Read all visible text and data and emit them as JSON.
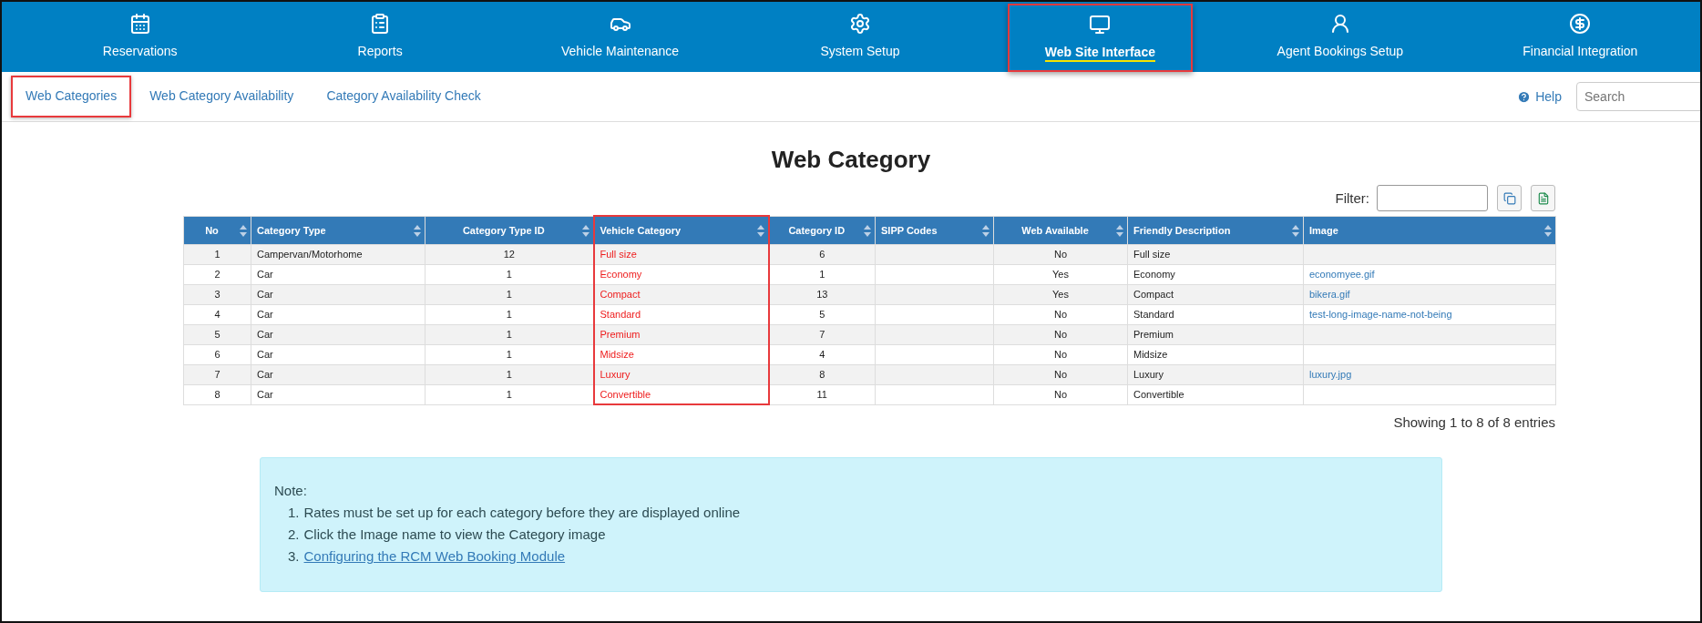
{
  "nav": [
    {
      "label": "Reservations",
      "selected": false
    },
    {
      "label": "Reports",
      "selected": false
    },
    {
      "label": "Vehicle Maintenance",
      "selected": false
    },
    {
      "label": "System Setup",
      "selected": false
    },
    {
      "label": "Web Site Interface",
      "selected": true
    },
    {
      "label": "Agent Bookings Setup",
      "selected": false
    },
    {
      "label": "Financial Integration",
      "selected": false
    }
  ],
  "tabs": [
    {
      "label": "Web Categories",
      "selected": true
    },
    {
      "label": "Web Category Availability",
      "selected": false
    },
    {
      "label": "Category Availability Check",
      "selected": false
    }
  ],
  "help": "Help",
  "search": {
    "placeholder": "Search"
  },
  "title": "Web Category",
  "filter_label": "Filter:",
  "table": {
    "columns": [
      {
        "label": "No",
        "kind": "text",
        "highlighted": false
      },
      {
        "label": "Category Type",
        "kind": "text",
        "highlighted": false
      },
      {
        "label": "Category Type ID",
        "kind": "text",
        "highlighted": false
      },
      {
        "label": "Vehicle Category",
        "kind": "accent",
        "highlighted": true
      },
      {
        "label": "Category ID",
        "kind": "text",
        "highlighted": false
      },
      {
        "label": "SIPP Codes",
        "kind": "text",
        "highlighted": false
      },
      {
        "label": "Web Available",
        "kind": "text",
        "highlighted": false
      },
      {
        "label": "Friendly Description",
        "kind": "text",
        "highlighted": false
      },
      {
        "label": "Image",
        "kind": "link",
        "highlighted": false
      }
    ],
    "rows": [
      [
        "1",
        "Campervan/Motorhome",
        "12",
        "Full size",
        "6",
        null,
        "No",
        "Full size",
        null
      ],
      [
        "2",
        "Car",
        "1",
        "Economy",
        "1",
        null,
        "Yes",
        "Economy",
        "economyee.gif"
      ],
      [
        "3",
        "Car",
        "1",
        "Compact",
        "13",
        null,
        "Yes",
        "Compact",
        "bikera.gif"
      ],
      [
        "4",
        "Car",
        "1",
        "Standard",
        "5",
        null,
        "No",
        "Standard",
        "test-long-image-name-not-being"
      ],
      [
        "5",
        "Car",
        "1",
        "Premium",
        "7",
        null,
        "No",
        "Premium",
        null
      ],
      [
        "6",
        "Car",
        "1",
        "Midsize",
        "4",
        null,
        "No",
        "Midsize",
        null
      ],
      [
        "7",
        "Car",
        "1",
        "Luxury",
        "8",
        null,
        "No",
        "Luxury",
        "luxury.jpg"
      ],
      [
        "8",
        "Car",
        "1",
        "Convertible",
        "11",
        null,
        "No",
        "Convertible",
        null
      ]
    ]
  },
  "entries_info": "Showing 1 to 8 of 8 entries",
  "note": {
    "title": "Note:",
    "items": [
      {
        "number": "1.",
        "text": "Rates must be set up for each category before they are displayed online",
        "kind": "text"
      },
      {
        "number": "2.",
        "text": "Click the Image name to view the Category image",
        "kind": "text"
      },
      {
        "number": "3.",
        "text": "Configuring the RCM Web Booking Module",
        "kind": "link"
      }
    ]
  }
}
